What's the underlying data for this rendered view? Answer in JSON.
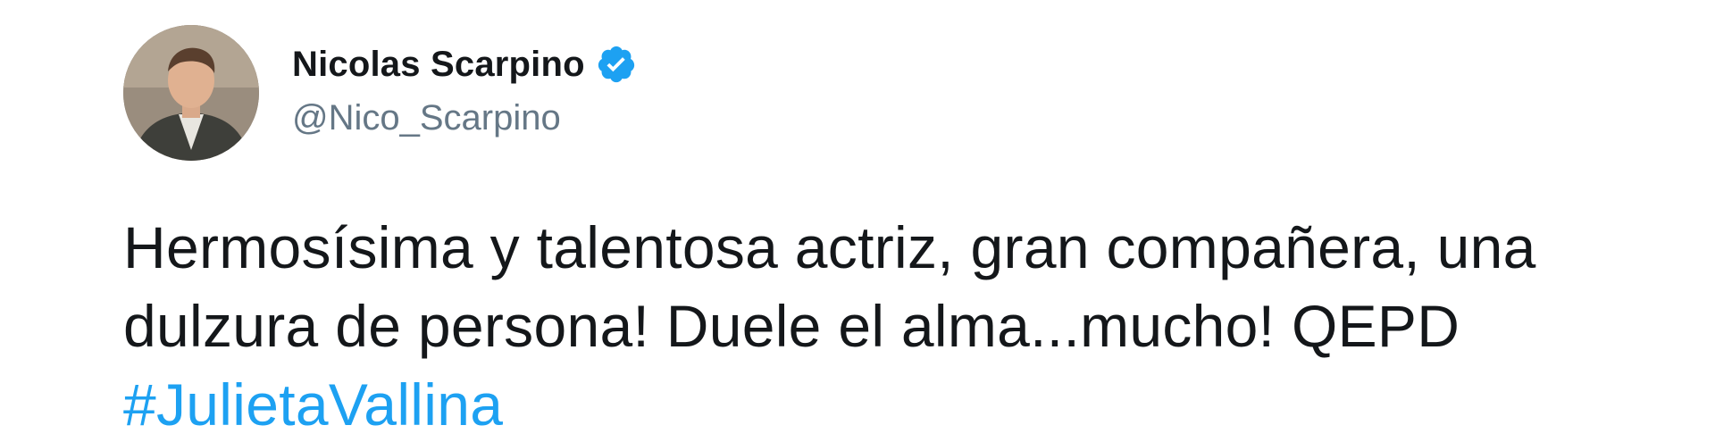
{
  "tweet": {
    "author": {
      "display_name": "Nicolas Scarpino",
      "handle": "@Nico_Scarpino",
      "verified": true,
      "avatar_icon": "profile-photo"
    },
    "text_lines": [
      "Hermosísima y talentosa actriz, gran compañera, una",
      "dulzura de persona! Duele el alma...mucho! QEPD"
    ],
    "hashtag": "#JulietaVallina",
    "colors": {
      "text": "#14171a",
      "handle": "#657786",
      "link": "#1da1f2",
      "verified_badge": "#1da1f2"
    }
  }
}
